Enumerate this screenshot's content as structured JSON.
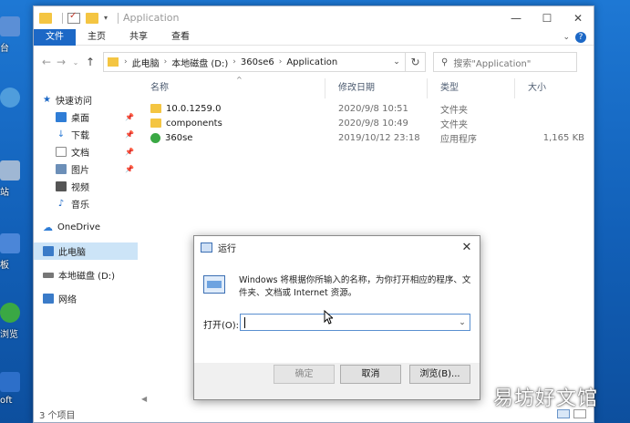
{
  "desktop": {
    "icons": [
      {
        "name": "desktop-icon-1",
        "label": "台",
        "color": "#5b8fd6"
      },
      {
        "name": "desktop-icon-2",
        "label": "",
        "color": "#4f9ddc"
      },
      {
        "name": "desktop-icon-3",
        "label": "站",
        "color": "#9fb7d4"
      },
      {
        "name": "desktop-icon-4",
        "label": "板",
        "color": "#4b86d8"
      },
      {
        "name": "desktop-icon-5",
        "label": "浏览",
        "color": "#3aa844"
      },
      {
        "name": "desktop-icon-6",
        "label": "oft",
        "color": "#2d6fc9"
      }
    ]
  },
  "explorer": {
    "title": "Application",
    "ribbon_tabs": [
      "文件",
      "主页",
      "共享",
      "查看"
    ],
    "breadcrumb": [
      "此电脑",
      "本地磁盘 (D:)",
      "360se6",
      "Application"
    ],
    "search_placeholder": "搜索\"Application\"",
    "nav_items": [
      {
        "label": "快速访问",
        "icon": "star-icon",
        "color": "#1c68c6",
        "sub": false,
        "pin": false
      },
      {
        "label": "桌面",
        "icon": "desktop-folder-icon",
        "color": "#2f7dd6",
        "sub": true,
        "pin": true
      },
      {
        "label": "下载",
        "icon": "download-icon",
        "color": "#2f7dd6",
        "sub": true,
        "pin": true
      },
      {
        "label": "文档",
        "icon": "document-icon",
        "color": "#8a8a8a",
        "sub": true,
        "pin": true
      },
      {
        "label": "图片",
        "icon": "picture-icon",
        "color": "#6c8fb8",
        "sub": true,
        "pin": true
      },
      {
        "label": "视频",
        "icon": "video-icon",
        "color": "#555555",
        "sub": true,
        "pin": false
      },
      {
        "label": "音乐",
        "icon": "music-icon",
        "color": "#1c68c6",
        "sub": true,
        "pin": false
      },
      {
        "label": "OneDrive",
        "icon": "cloud-icon",
        "color": "#2f7dd6",
        "sub": false,
        "pin": false,
        "gap": true
      },
      {
        "label": "此电脑",
        "icon": "computer-icon",
        "color": "#3a7bc8",
        "sub": false,
        "pin": false,
        "gap": true,
        "selected": true
      },
      {
        "label": "本地磁盘 (D:)",
        "icon": "drive-icon",
        "color": "#777777",
        "sub": false,
        "pin": false,
        "gap": true
      },
      {
        "label": "网络",
        "icon": "network-icon",
        "color": "#3a7bc8",
        "sub": false,
        "pin": false,
        "gap": true
      }
    ],
    "columns": [
      "名称",
      "修改日期",
      "类型",
      "大小"
    ],
    "files": [
      {
        "name": "10.0.1259.0",
        "date": "2020/9/8 10:51",
        "type": "文件夹",
        "size": "",
        "icon": "folder-icon",
        "color": "#f4c542"
      },
      {
        "name": "components",
        "date": "2020/9/8 10:49",
        "type": "文件夹",
        "size": "",
        "icon": "folder-icon",
        "color": "#f4c542"
      },
      {
        "name": "360se",
        "date": "2019/10/12 23:18",
        "type": "应用程序",
        "size": "1,165 KB",
        "icon": "360se-app-icon",
        "color": "#3aa844"
      }
    ],
    "status": "3 个项目"
  },
  "run_dialog": {
    "title": "运行",
    "description": "Windows 将根据你所输入的名称，为你打开相应的程序、文件夹、文档或 Internet 资源。",
    "open_label": "打开(O):",
    "input_value": "",
    "ok_label": "确定",
    "cancel_label": "取消",
    "browse_label": "浏览(B)..."
  },
  "watermark": "易坊好文馆"
}
